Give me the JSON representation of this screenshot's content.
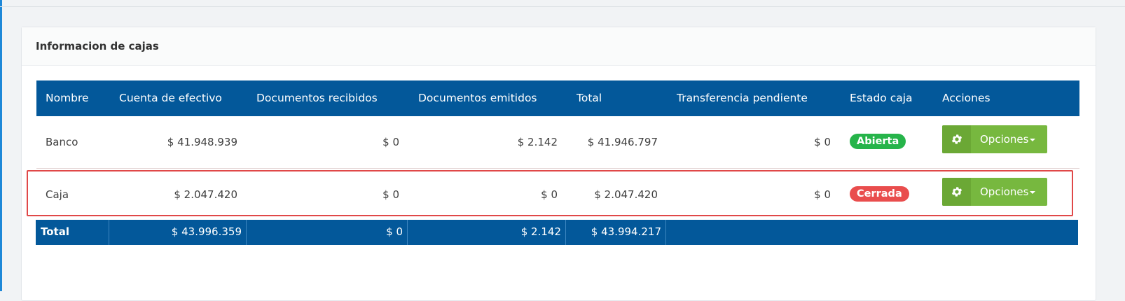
{
  "panel": {
    "title": "Informacion de cajas"
  },
  "table": {
    "headers": {
      "nombre": "Nombre",
      "cuenta": "Cuenta de efectivo",
      "recibidos": "Documentos recibidos",
      "emitidos": "Documentos emitidos",
      "total": "Total",
      "transferencia": "Transferencia pendiente",
      "estado": "Estado caja",
      "acciones": "Acciones"
    },
    "rows": [
      {
        "nombre": "Banco",
        "cuenta": "$ 41.948.939",
        "recibidos": "$ 0",
        "emitidos": "$ 2.142",
        "total": "$ 41.946.797",
        "transferencia": "$ 0",
        "estado": "Abierta",
        "estado_color": "#26b44a",
        "accion": "Opciones"
      },
      {
        "nombre": "Caja",
        "cuenta": "$ 2.047.420",
        "recibidos": "$ 0",
        "emitidos": "$ 0",
        "total": "$ 2.047.420",
        "transferencia": "$ 0",
        "estado": "Cerrada",
        "estado_color": "#e94d4d",
        "accion": "Opciones"
      }
    ],
    "footer": {
      "label": "Total",
      "cuenta": "$ 43.996.359",
      "recibidos": "$ 0",
      "emitidos": "$ 2.142",
      "total": "$ 43.994.217"
    }
  },
  "colors": {
    "header_bg": "#03589a",
    "button_green": "#77b83f",
    "highlight": "#e04848"
  },
  "icons": {
    "options": "gear-icon",
    "dropdown": "caret-down-icon"
  }
}
